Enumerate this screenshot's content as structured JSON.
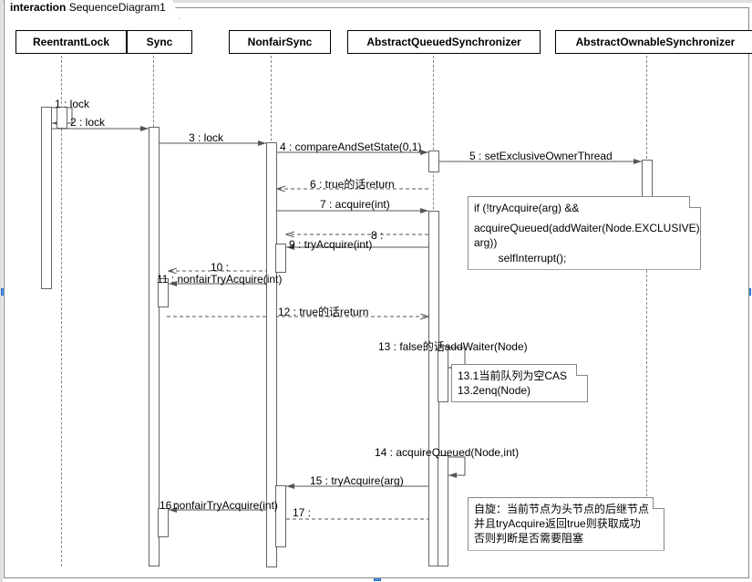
{
  "frame": {
    "keyword": "interaction",
    "title": "SequenceDiagram1"
  },
  "lifelines": {
    "reentrantLock": "ReentrantLock",
    "sync": "Sync",
    "nonfairSync": "NonfairSync",
    "aqs": "AbstractQueuedSynchronizer",
    "aos": "AbstractOwnableSynchronizer"
  },
  "messages": {
    "m1": "1 : lock",
    "m2": "2 : lock",
    "m3": "3 : lock",
    "m4": "4 : compareAndSetState(0,1)",
    "m5": "5 : setExclusiveOwnerThread",
    "m6": "6 : true的话return",
    "m7": "7 : acquire(int)",
    "m8": "8 :",
    "m9": "9 : tryAcquire(int)",
    "m10": "10 :",
    "m11": "11 : nonfairTryAcquire(int)",
    "m12": "12 : true的话return",
    "m13": "13 : false的话addWaiter(Node)",
    "m14": "14 : acquireQueued(Node,int)",
    "m15": "15 : tryAcquire(arg)",
    "m16_num": "16 :",
    "m16": "nonfairTryAcquire(int)",
    "m17": "17 :"
  },
  "notes": {
    "n1_l1": "if (!tryAcquire(arg) &&",
    "n1_l2": "acquireQueued(addWaiter(Node.EXCLUSIVE),",
    "n1_l3": "arg))",
    "n1_l4": "        selfInterrupt();",
    "n2_l1": "13.1当前队列为空CAS",
    "n2_l2": "13.2enq(Node)",
    "n3_l1": "自旋：当前节点为头节点的后继节点",
    "n3_l2": "并且tryAcquire返回true则获取成功",
    "n3_l3": "否则判断是否需要阻塞"
  },
  "chart_data": {
    "type": "table",
    "diagram_kind": "UML sequence diagram",
    "title": "interaction SequenceDiagram1",
    "lifelines": [
      "ReentrantLock",
      "Sync",
      "NonfairSync",
      "AbstractQueuedSynchronizer",
      "AbstractOwnableSynchronizer"
    ],
    "messages": [
      {
        "n": 1,
        "from": "ReentrantLock",
        "to": "ReentrantLock",
        "label": "lock",
        "kind": "self"
      },
      {
        "n": 2,
        "from": "ReentrantLock",
        "to": "Sync",
        "label": "lock",
        "kind": "call"
      },
      {
        "n": 3,
        "from": "Sync",
        "to": "NonfairSync",
        "label": "lock",
        "kind": "call"
      },
      {
        "n": 4,
        "from": "NonfairSync",
        "to": "AbstractQueuedSynchronizer",
        "label": "compareAndSetState(0,1)",
        "kind": "call"
      },
      {
        "n": 5,
        "from": "AbstractQueuedSynchronizer",
        "to": "AbstractOwnableSynchronizer",
        "label": "setExclusiveOwnerThread",
        "kind": "call"
      },
      {
        "n": 6,
        "from": "AbstractQueuedSynchronizer",
        "to": "NonfairSync",
        "label": "true的话return",
        "kind": "return"
      },
      {
        "n": 7,
        "from": "NonfairSync",
        "to": "AbstractQueuedSynchronizer",
        "label": "acquire(int)",
        "kind": "call"
      },
      {
        "n": 8,
        "from": "AbstractQueuedSynchronizer",
        "to": "NonfairSync",
        "label": "",
        "kind": "return"
      },
      {
        "n": 9,
        "from": "AbstractQueuedSynchronizer",
        "to": "NonfairSync",
        "label": "tryAcquire(int)",
        "kind": "call"
      },
      {
        "n": 10,
        "from": "NonfairSync",
        "to": "Sync",
        "label": "",
        "kind": "return"
      },
      {
        "n": 11,
        "from": "NonfairSync",
        "to": "Sync",
        "label": "nonfairTryAcquire(int)",
        "kind": "call"
      },
      {
        "n": 12,
        "from": "Sync",
        "to": "AbstractQueuedSynchronizer",
        "label": "true的话return",
        "kind": "return"
      },
      {
        "n": 13,
        "from": "AbstractQueuedSynchronizer",
        "to": "AbstractQueuedSynchronizer",
        "label": "false的话addWaiter(Node)",
        "kind": "self"
      },
      {
        "n": 14,
        "from": "AbstractQueuedSynchronizer",
        "to": "AbstractQueuedSynchronizer",
        "label": "acquireQueued(Node,int)",
        "kind": "self"
      },
      {
        "n": 15,
        "from": "AbstractQueuedSynchronizer",
        "to": "NonfairSync",
        "label": "tryAcquire(arg)",
        "kind": "call"
      },
      {
        "n": 16,
        "from": "NonfairSync",
        "to": "Sync",
        "label": "nonfairTryAcquire(int)",
        "kind": "call"
      },
      {
        "n": 17,
        "from": "NonfairSync",
        "to": "AbstractQueuedSynchronizer",
        "label": "",
        "kind": "return"
      }
    ],
    "notes": [
      {
        "attached_to": 7,
        "text": "if (!tryAcquire(arg) && acquireQueued(addWaiter(Node.EXCLUSIVE), arg)) selfInterrupt();"
      },
      {
        "attached_to": 13,
        "text": "13.1当前队列为空CAS 13.2enq(Node)"
      },
      {
        "attached_to": 14,
        "text": "自旋：当前节点为头节点的后继节点 并且tryAcquire返回true则获取成功 否则判断是否需要阻塞"
      }
    ]
  }
}
